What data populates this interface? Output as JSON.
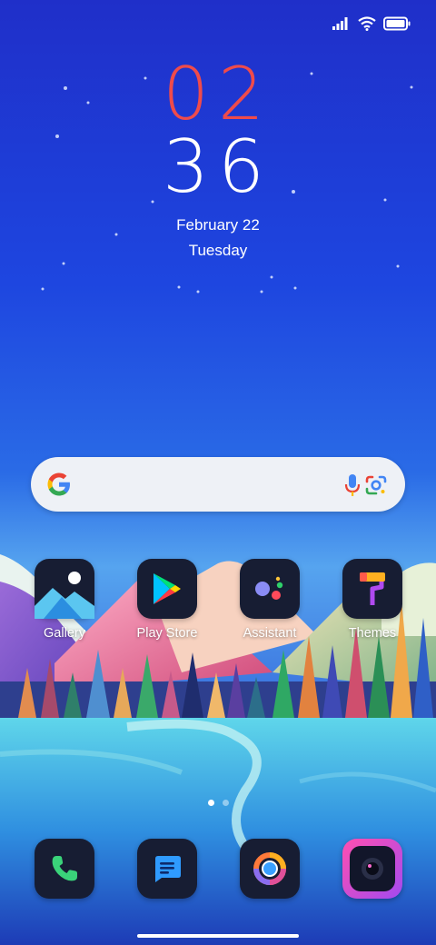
{
  "status_bar": {
    "icons": [
      "signal-icon",
      "wifi-icon",
      "battery-icon"
    ]
  },
  "clock": {
    "hour": "02",
    "minute": "36",
    "date": "February 22",
    "weekday": "Tuesday"
  },
  "search": {
    "logo": "google-g-icon",
    "mic_icon": "mic-icon",
    "lens_icon": "lens-camera-icon"
  },
  "apps": [
    {
      "label": "Gallery",
      "icon": "gallery-icon"
    },
    {
      "label": "Play Store",
      "icon": "play-store-icon"
    },
    {
      "label": "Assistant",
      "icon": "assistant-icon"
    },
    {
      "label": "Themes",
      "icon": "themes-icon"
    }
  ],
  "page_indicator": {
    "pages": 2,
    "current": 1
  },
  "dock": [
    {
      "icon": "phone-icon"
    },
    {
      "icon": "messages-icon"
    },
    {
      "icon": "browser-icon"
    },
    {
      "icon": "camera-icon"
    }
  ],
  "colors": {
    "hour": "#ef4b4b",
    "minute": "#ffffff",
    "icon_bg": "#171d33"
  }
}
